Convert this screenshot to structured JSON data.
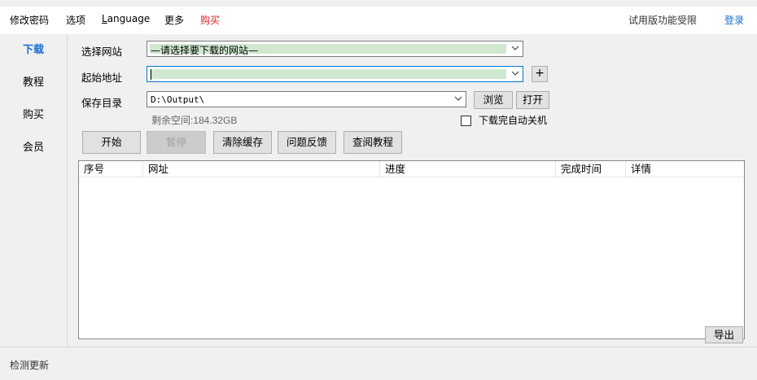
{
  "menu": {
    "change_password": "修改密码",
    "options": "选项",
    "language": "Language",
    "more": "更多",
    "buy": "购买",
    "trial_notice": "试用版功能受限",
    "login": "登录"
  },
  "sidebar": {
    "items": [
      {
        "label": "下载",
        "active": true
      },
      {
        "label": "教程",
        "active": false
      },
      {
        "label": "购买",
        "active": false
      },
      {
        "label": "会员",
        "active": false
      }
    ]
  },
  "form": {
    "site_label": "选择网站",
    "site_value": "—请选择要下载的网站—",
    "start_url_label": "起始地址",
    "start_url_value": "",
    "add_button": "+",
    "save_dir_label": "保存目录",
    "save_dir_value": "D:\\Output\\",
    "browse_button": "浏览",
    "open_button": "打开",
    "free_space": "剩余空间:184.32GB",
    "shutdown_checkbox_label": "下载完自动关机",
    "shutdown_checked": false
  },
  "actions": {
    "start": "开始",
    "pause": "暂停",
    "clear_cache": "清除缓存",
    "feedback": "问题反馈",
    "tutorial": "查阅教程"
  },
  "table": {
    "columns": [
      "序号",
      "网址",
      "进度",
      "完成时间",
      "详情"
    ],
    "rows": []
  },
  "export_button": "导出",
  "status": {
    "check_update": "检测更新"
  },
  "colors": {
    "accent": "#1a6fd0",
    "buy_red": "#e02020",
    "selection_green": "#cfe8cf"
  }
}
